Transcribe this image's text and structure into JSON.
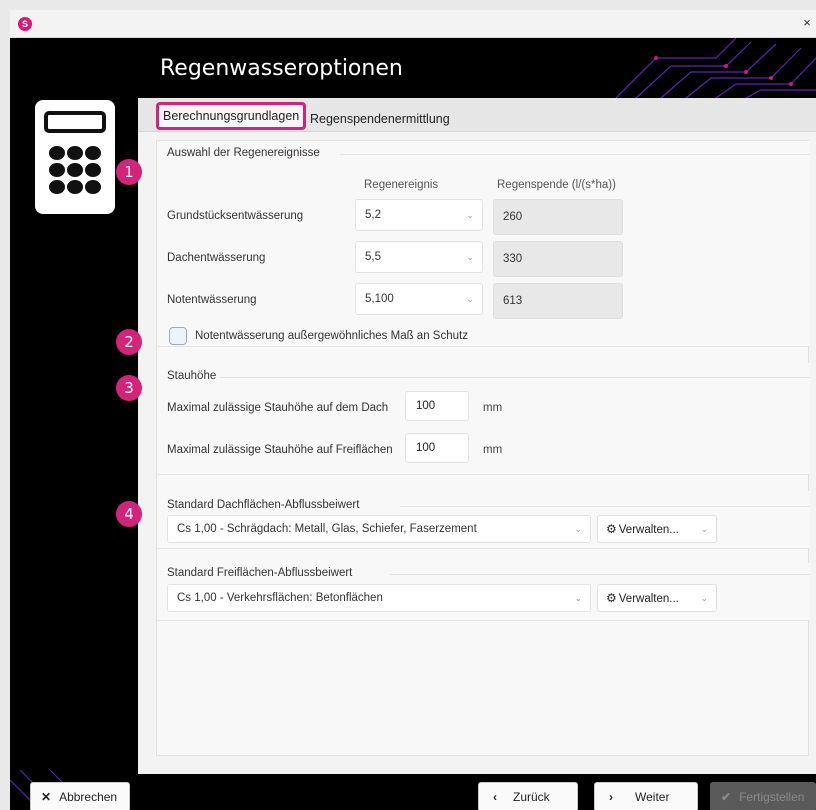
{
  "window": {
    "close_glyph": "×",
    "title": "Regenwasseroptionen"
  },
  "tabs": [
    {
      "label": "Berechnungsgrundlagen"
    },
    {
      "label": "Regenspendenermittlung"
    }
  ],
  "badges": [
    "1",
    "2",
    "3",
    "4"
  ],
  "rain_events": {
    "legend": "Auswahl der Regenereignisse",
    "col_event": "Regenereignis",
    "col_rate": "Regenspende (l/(s*ha))",
    "rows": [
      {
        "label": "Grundstücksentwässerung",
        "event": "5,2",
        "rate": "260"
      },
      {
        "label": "Dachentwässerung",
        "event": "5,5",
        "rate": "330"
      },
      {
        "label": "Notentwässerung",
        "event": "5,100",
        "rate": "613"
      }
    ],
    "checkbox_label": "Notentwässerung außergewöhnliches Maß an Schutz",
    "checkbox_checked": false
  },
  "stauhoehe": {
    "legend": "Stauhöhe",
    "roof_label": "Maximal zulässige Stauhöhe auf dem Dach",
    "roof_value": "100",
    "open_label": "Maximal zulässige Stauhöhe auf Freiflächen",
    "open_value": "100",
    "unit": "mm"
  },
  "roof_coeff": {
    "legend": "Standard Dachflächen-Abflussbeiwert",
    "value": "Cs 1,00 - Schrägdach: Metall, Glas, Schiefer, Faserzement",
    "manage_label": "Verwalten..."
  },
  "open_coeff": {
    "legend": "Standard Freiflächen-Abflussbeiwert",
    "value": "Cs 1,00 - Verkehrsflächen: Betonflächen",
    "manage_label": "Verwalten..."
  },
  "footer": {
    "cancel": "Abbrechen",
    "back": "Zurück",
    "next": "Weiter",
    "finish": "Fertigstellen"
  },
  "colors": {
    "accent": "#d4237a",
    "background_dark": "#000000",
    "circuit": "#6a2bd8"
  }
}
